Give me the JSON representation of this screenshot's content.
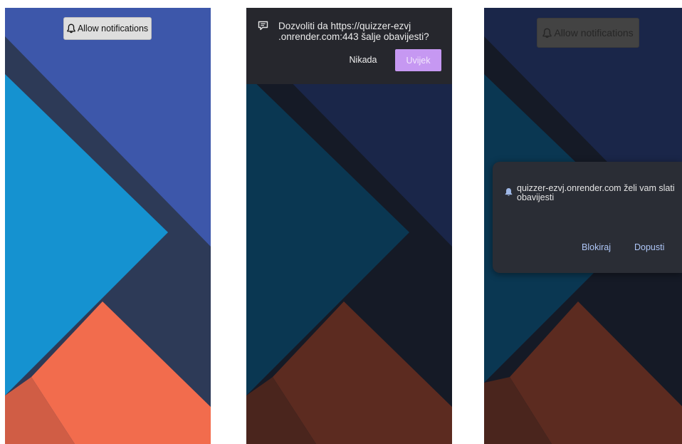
{
  "screens": [
    {
      "id": "screen-initial",
      "allow_button": {
        "icon": "bell-icon",
        "label": "Allow notifications"
      }
    },
    {
      "id": "screen-firefox-prompt",
      "prompt": {
        "icon": "message-icon",
        "text": "Dozvoliti da https://quizzer-ezvj .onrender.com:443 šalje obavijesti?",
        "never_label": "Nikada",
        "always_label": "Uvijek"
      }
    },
    {
      "id": "screen-chrome-prompt",
      "allow_button": {
        "icon": "bell-icon",
        "label": "Allow notifications"
      },
      "dialog": {
        "icon": "bell-icon",
        "text": "quizzer-ezvj.onrender.com želi vam slati obavijesti",
        "block_label": "Blokiraj",
        "allow_label": "Dopusti"
      }
    }
  ],
  "colors": {
    "top_blue": "#3d57aa",
    "band_navy": "#2d3a57",
    "light_blue": "#1592d0",
    "orange": "#f26c4d",
    "orange_dark": "#d05d45",
    "prompt_accent": "#c698f2",
    "link_blue": "#aec6f7"
  }
}
